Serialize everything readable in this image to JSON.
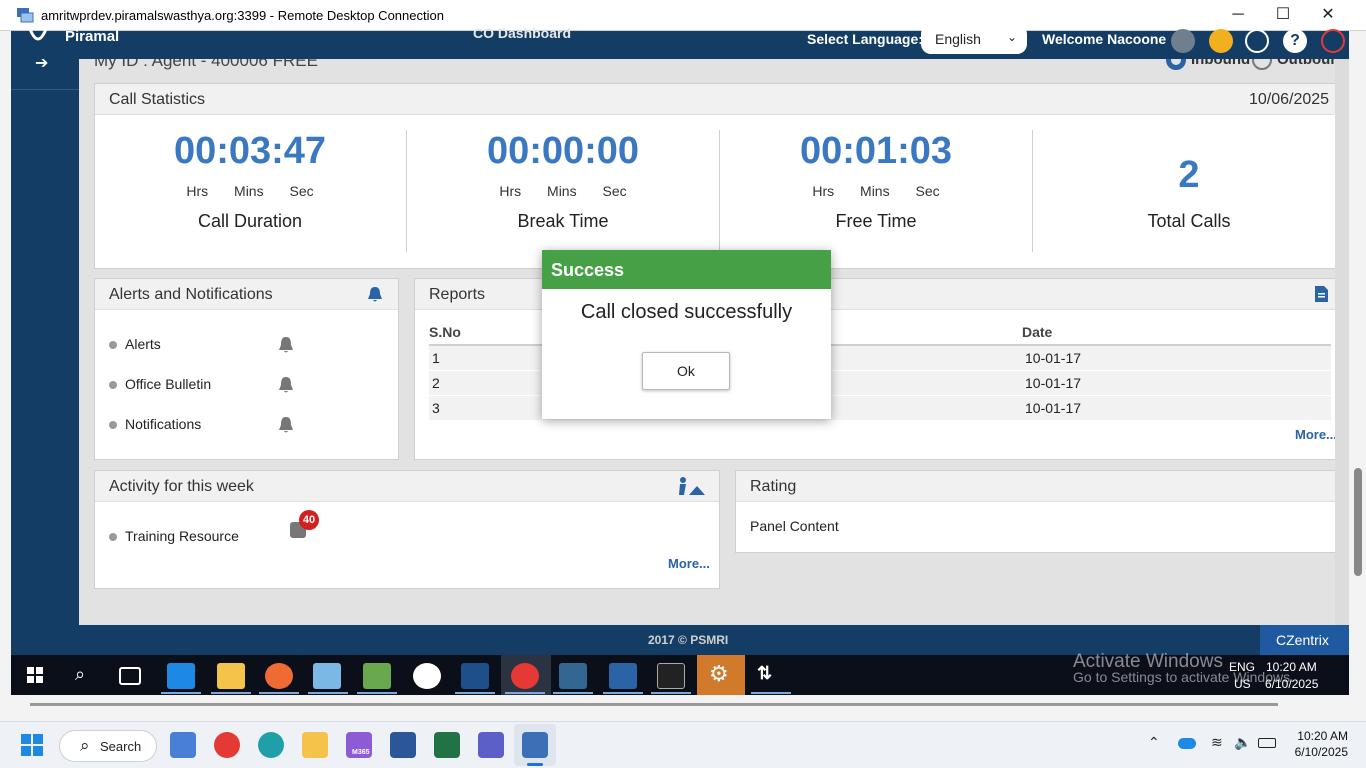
{
  "rdp": {
    "title": "amritwprdev.piramalswasthya.org:3399 - Remote Desktop Connection",
    "minimize": "─",
    "maximize": "☐",
    "close": "✕"
  },
  "header": {
    "logo": "Piramal",
    "dashboard_title": "CO Dashboard",
    "select_language_label": "Select Language:",
    "language_value": "English",
    "welcome": "Welcome Nacoone",
    "colors": {
      "bar": "#143d66",
      "flag": "#f2b01e",
      "power": "#e53935"
    }
  },
  "agent": {
    "id_text": "My ID : Agent - 400006 FREE",
    "inbound": "Inbound",
    "outbound": "Outbound"
  },
  "call_statistics": {
    "title": "Call Statistics",
    "date": "10/06/2025",
    "units": "Hrs Mins Sec",
    "stats": [
      {
        "time": "00:03:47",
        "label": "Call Duration"
      },
      {
        "time": "00:00:00",
        "label": "Break Time"
      },
      {
        "time": "00:01:03",
        "label": "Free Time"
      }
    ],
    "total_calls_value": "2",
    "total_calls_label": "Total Calls"
  },
  "alerts": {
    "title": "Alerts and Notifications",
    "items": [
      "Alerts",
      "Office Bulletin",
      "Notifications"
    ]
  },
  "reports": {
    "title": "Reports",
    "col_sno": "S.No",
    "col_date": "Date",
    "rows": [
      {
        "sno": "1",
        "date": "10-01-17"
      },
      {
        "sno": "2",
        "date": "10-01-17"
      },
      {
        "sno": "3",
        "date": "10-01-17"
      }
    ],
    "more": "More..."
  },
  "activity": {
    "title": "Activity for this week",
    "item": "Training Resource",
    "badge": "40",
    "more": "More..."
  },
  "rating": {
    "title": "Rating",
    "content": "Panel Content"
  },
  "footer": {
    "copyright": "2017 © PSMRI",
    "brand": "CZentrix"
  },
  "modal": {
    "title": "Success",
    "message": "Call closed successfully",
    "ok": "Ok",
    "header_color": "#45a046"
  },
  "remote_taskbar": {
    "activate_title": "Activate Windows",
    "activate_sub": "Go to Settings to activate Windows.",
    "lang_top": "ENG",
    "lang_bottom": "US",
    "time": "10:20 AM",
    "date": "6/10/2025"
  },
  "host_taskbar": {
    "search": "Search",
    "m365": "M365",
    "time": "10:20 AM",
    "date": "6/10/2025"
  }
}
